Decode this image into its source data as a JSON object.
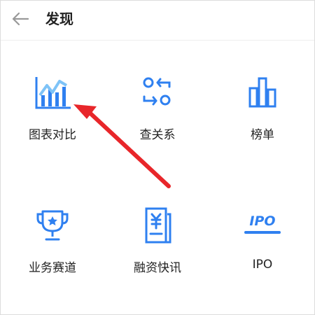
{
  "header": {
    "title": "发现",
    "back_icon": "arrow-left-icon"
  },
  "colors": {
    "accent": "#2f80f0",
    "arrow": "#e8262a"
  },
  "features": [
    {
      "label": "图表对比",
      "icon": "chart-compare-icon"
    },
    {
      "label": "查关系",
      "icon": "relation-icon"
    },
    {
      "label": "榜单",
      "icon": "ranking-icon"
    },
    {
      "label": "业务赛道",
      "icon": "trophy-icon"
    },
    {
      "label": "融资快讯",
      "icon": "finance-news-icon"
    },
    {
      "label": "IPO",
      "icon": "ipo-icon",
      "icon_text": "IPO"
    }
  ]
}
